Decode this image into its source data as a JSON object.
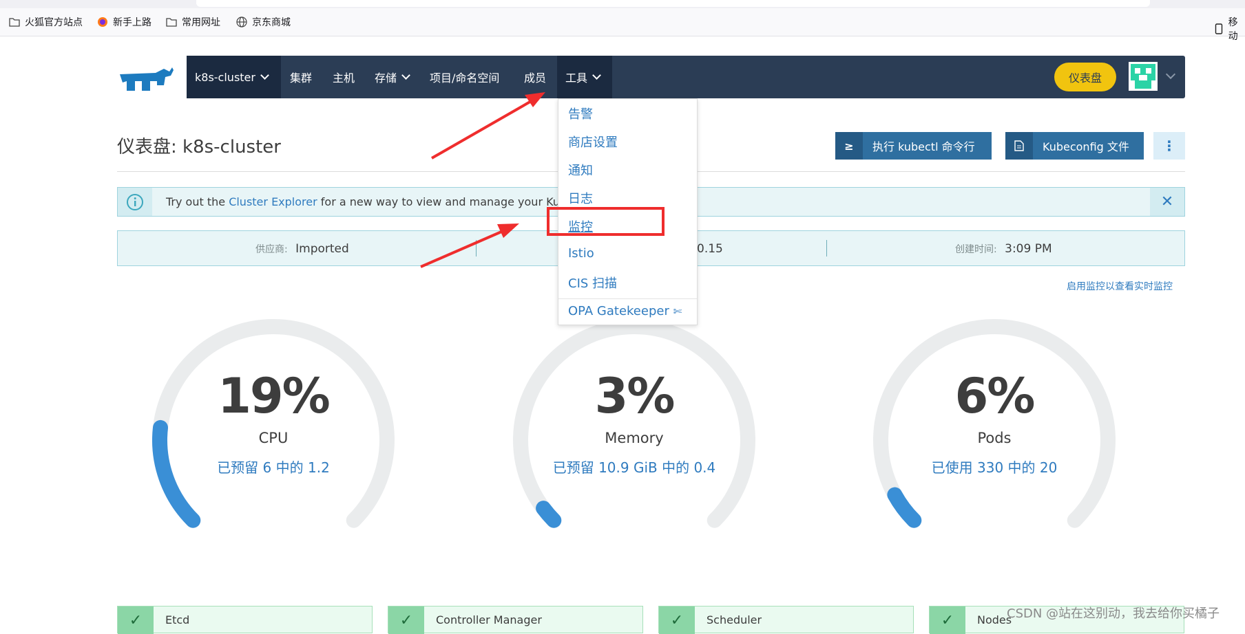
{
  "browser": {
    "bookmarks": [
      {
        "label": "火狐官方站点",
        "icon": "folder-icon"
      },
      {
        "label": "新手上路",
        "icon": "firefox-icon"
      },
      {
        "label": "常用网址",
        "icon": "folder-icon"
      },
      {
        "label": "京东商城",
        "icon": "globe-icon"
      }
    ],
    "mobile_label": "移动"
  },
  "navbar": {
    "cluster": "k8s-cluster",
    "items": [
      "集群",
      "主机",
      "存储",
      "项目/命名空间",
      "成员",
      "工具"
    ],
    "dashboard_button": "仪表盘"
  },
  "tools_menu": {
    "items": [
      "告警",
      "商店设置",
      "通知",
      "日志",
      "监控",
      "Istio",
      "CIS 扫描"
    ],
    "gatekeeper": "OPA Gatekeeper",
    "highlighted": "监控"
  },
  "page": {
    "title": "仪表盘: k8s-cluster",
    "kubectl_button": "执行 kubectl 命令行",
    "kubeconfig_button": "Kubeconfig 文件"
  },
  "banner": {
    "prefix": "Try out the ",
    "link": "Cluster Explorer",
    "suffix": " for a new way to view and manage your Kub"
  },
  "info": {
    "provider_key": "供应商:",
    "provider_value": "Imported",
    "version_value": "0.15",
    "created_key": "创建时间:",
    "created_value": "3:09 PM"
  },
  "monitor_link": "启用监控以查看实时监控",
  "gauges": [
    {
      "value": "19%",
      "label": "CPU",
      "detail": "已预留 6 中的 1.2",
      "fraction": 0.19
    },
    {
      "value": "3%",
      "label": "Memory",
      "detail": "已预留 10.9 GiB 中的 0.4",
      "fraction": 0.03
    },
    {
      "value": "6%",
      "label": "Pods",
      "detail": "已使用 330 中的 20",
      "fraction": 0.06
    }
  ],
  "components": [
    "Etcd",
    "Controller Manager",
    "Scheduler",
    "Nodes"
  ],
  "watermark": "CSDN @站在这别动，我去给你买橘子",
  "colors": {
    "navbar": "#2b3d55",
    "accent": "#2f7bbf",
    "dashboard_button": "#f1c40f",
    "annotation_red": "#ef2d2d",
    "gauge_fill": "#3a8fd6",
    "healthy": "#8bd6a6"
  }
}
